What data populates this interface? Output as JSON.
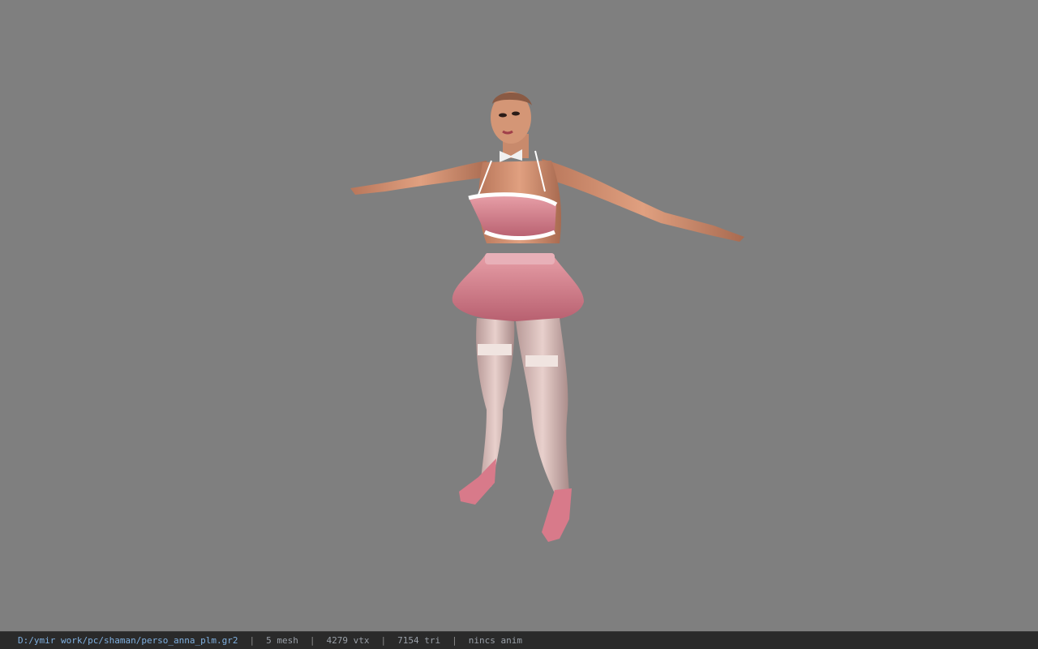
{
  "status_bar": {
    "file_path": "D:/ymir work/pc/shaman/perso_anna_plm.gr2",
    "separator": "|",
    "mesh_count": "5 mesh",
    "vertex_count": "4279 vtx",
    "triangle_count": "7154 tri",
    "anim_status": "nincs anim"
  },
  "colors": {
    "viewport_background": "#7f7f7f",
    "statusbar_background": "#2a2a2a",
    "path_text": "#7fb0e0"
  }
}
